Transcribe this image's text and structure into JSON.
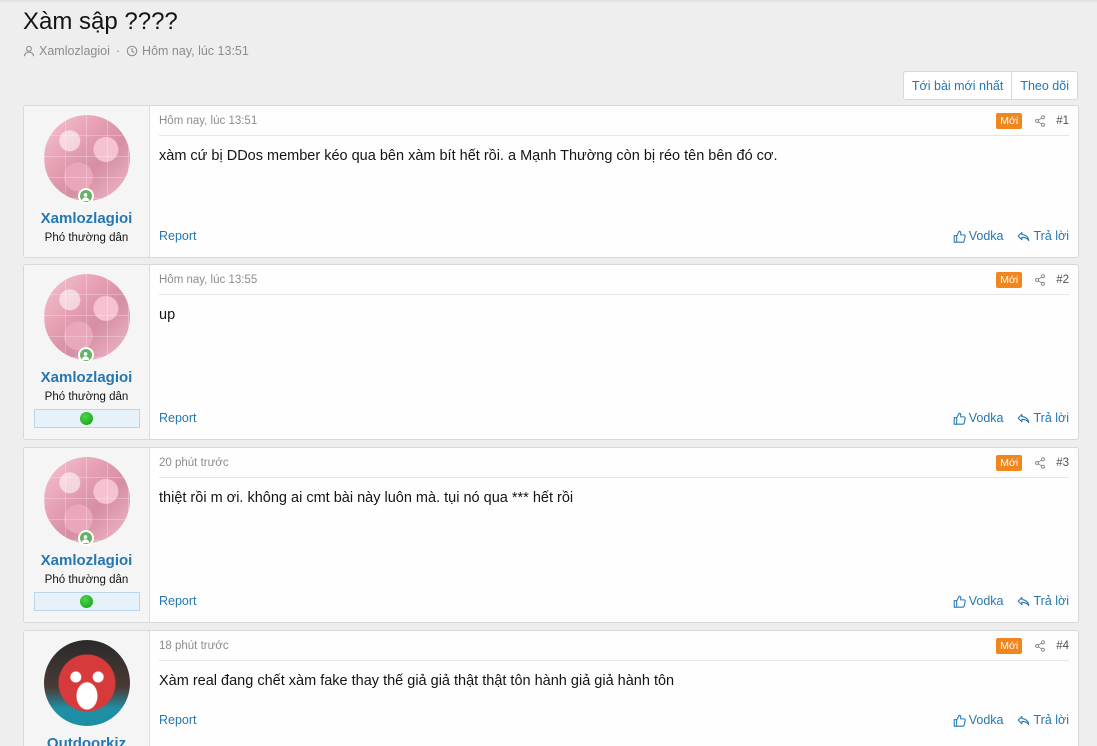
{
  "thread": {
    "title": "Xàm sập ????",
    "author": "Xamlozlagioi",
    "separator": "·",
    "date": "Hôm nay, lúc 13:51"
  },
  "buttons": {
    "latest": "Tới bài mới nhất",
    "follow": "Theo dõi"
  },
  "labels": {
    "new_badge": "Mới",
    "report": "Report",
    "like": "Vodka",
    "reply": "Trả lời"
  },
  "posts": [
    {
      "username": "Xamlozlagioi",
      "user_title": "Phó thường dân",
      "date": "Hôm nay, lúc 13:51",
      "number": "#1",
      "body": "xàm cứ bị DDos member kéo qua bên xàm bít hết rồi. a Mạnh Thường còn bị réo tên bên đó cơ."
    },
    {
      "username": "Xamlozlagioi",
      "user_title": "Phó thường dân",
      "date": "Hôm nay, lúc 13:55",
      "number": "#2",
      "body": "up"
    },
    {
      "username": "Xamlozlagioi",
      "user_title": "Phó thường dân",
      "date": "20 phút trước",
      "number": "#3",
      "body": "thiệt rồi m ơi. không ai cmt bài này luôn mà. tụi nó qua *** hết rồi"
    },
    {
      "username": "Outdoorkiz",
      "date": "18 phút trước",
      "number": "#4",
      "body": "Xàm real đang chết xàm fake thay thế giả giả thật thật tôn hành giả giả hành tôn"
    }
  ],
  "colors": {
    "link": "#2577b1",
    "badge_new": "#f0861e",
    "online": "#63b265"
  }
}
